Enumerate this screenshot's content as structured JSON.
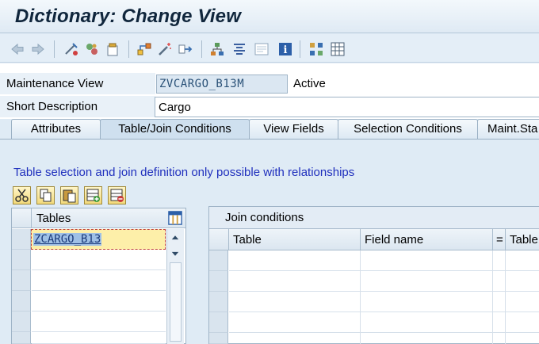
{
  "window": {
    "title": "Dictionary: Change View"
  },
  "toolbar": {
    "icons": [
      "back-icon",
      "forward-icon",
      "other-object-icon",
      "display-change-icon",
      "activate-icon",
      "where-used-icon",
      "object-list-icon",
      "magic-wand-icon",
      "navigate-icon",
      "hierarchy-icon",
      "layout-icon",
      "display-icon",
      "info-icon",
      "grid-icon",
      "table-icon"
    ]
  },
  "form": {
    "maintenance_view_label": "Maintenance View",
    "maintenance_view_value": "ZVCARGO_B13M",
    "status": "Active",
    "short_description_label": "Short Description",
    "short_description_value": "Cargo"
  },
  "tabs": [
    {
      "label": "Attributes",
      "active": false
    },
    {
      "label": "Table/Join Conditions",
      "active": true
    },
    {
      "label": "View Fields",
      "active": false
    },
    {
      "label": "Selection Conditions",
      "active": false
    },
    {
      "label": "Maint.Sta",
      "active": false
    }
  ],
  "panel": {
    "info_text": "Table selection and join definition only possible with relationships",
    "buttons": [
      "cut-icon",
      "copy-icon",
      "paste-icon",
      "insert-row-icon",
      "delete-row-icon"
    ]
  },
  "tables_grid": {
    "header": "Tables",
    "rows": [
      "ZCARGO_B13",
      "",
      "",
      "",
      "",
      ""
    ]
  },
  "join_grid": {
    "title": "Join conditions",
    "columns": [
      "Table",
      "Field name",
      "=",
      "Table"
    ]
  },
  "colors": {
    "background": "#dfebf5",
    "title": "#10263c",
    "info_text": "#1f2fbd",
    "selected_cell": "#fdefa9"
  }
}
